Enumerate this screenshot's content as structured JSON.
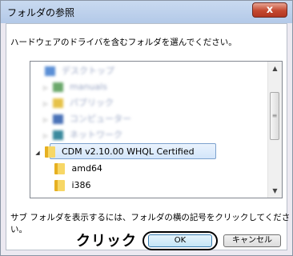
{
  "window": {
    "title": "フォルダの参照",
    "close_label": "x"
  },
  "instruction": "ハードウェアのドライバを含むフォルダを選んでください。",
  "tree": {
    "items": [
      {
        "label": "デスクトップ",
        "icon": "desktop-icon"
      },
      {
        "label": "manuals",
        "icon": "library-icon"
      },
      {
        "label": "パブリック",
        "icon": "folder-icon"
      },
      {
        "label": "コンピューター",
        "icon": "computer-icon"
      },
      {
        "label": "ネットワーク",
        "icon": "network-icon"
      }
    ],
    "selected": "CDM v2.10.00 WHQL Certified",
    "children": [
      "amd64",
      "i386"
    ]
  },
  "hint": "サブ フォルダを表示するには、フォルダの横の記号をクリックしてください。",
  "buttons": {
    "ok": "OK",
    "cancel": "キャンセル"
  },
  "annotation": {
    "click_label": "クリック"
  }
}
